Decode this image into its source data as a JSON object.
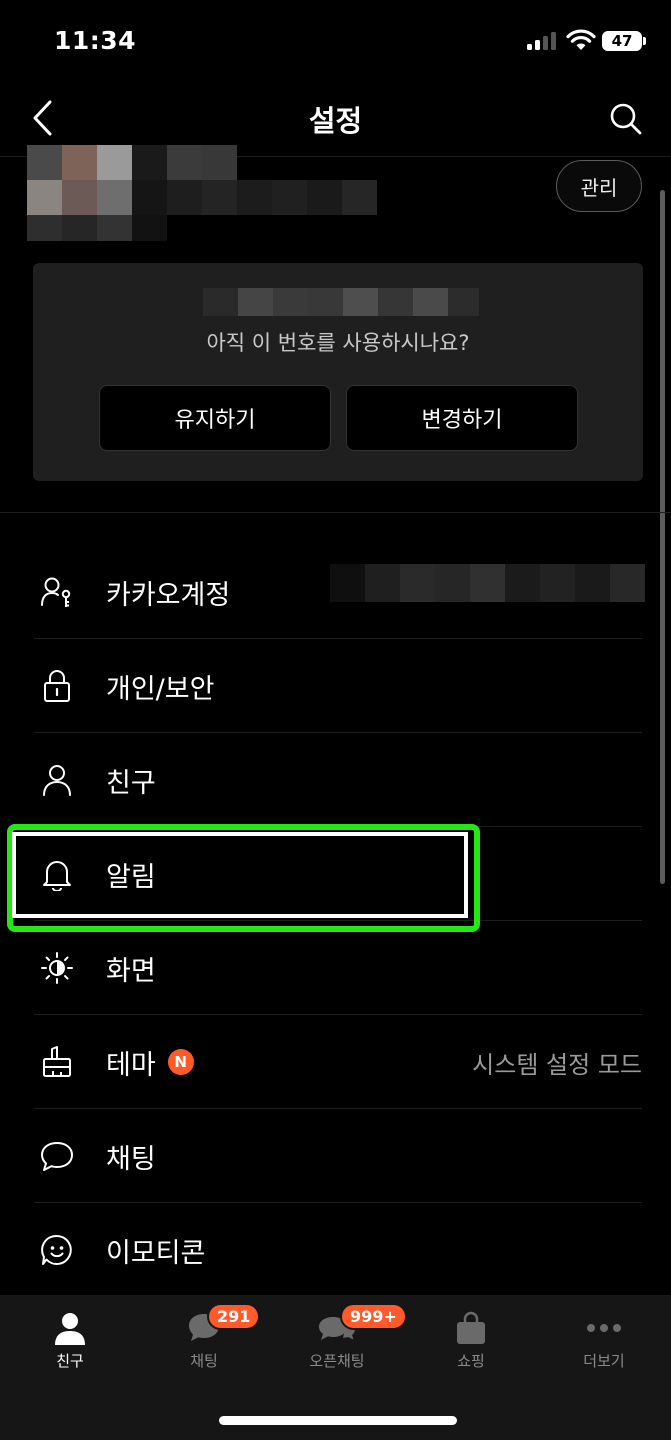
{
  "status": {
    "time": "11:34",
    "battery": "47"
  },
  "header": {
    "title": "설정"
  },
  "profile": {
    "manage_label": "관리"
  },
  "phone_check": {
    "question": "아직 이 번호를 사용하시나요?",
    "keep_label": "유지하기",
    "change_label": "변경하기"
  },
  "menu": [
    {
      "label": "카카오계정",
      "icon": "account-key-icon"
    },
    {
      "label": "개인/보안",
      "icon": "lock-icon"
    },
    {
      "label": "친구",
      "icon": "person-icon"
    },
    {
      "label": "알림",
      "icon": "bell-icon"
    },
    {
      "label": "화면",
      "icon": "brightness-icon"
    },
    {
      "label": "테마",
      "icon": "brush-icon",
      "badge": "N",
      "value": "시스템 설정 모드"
    },
    {
      "label": "채팅",
      "icon": "chat-bubble-icon"
    },
    {
      "label": "이모티콘",
      "icon": "emoticon-icon"
    }
  ],
  "tabs": [
    {
      "label": "친구",
      "icon": "person-icon",
      "active": true
    },
    {
      "label": "채팅",
      "icon": "chat-bubble-icon",
      "badge": "291"
    },
    {
      "label": "오픈채팅",
      "icon": "open-chat-icon",
      "badge": "999+"
    },
    {
      "label": "쇼핑",
      "icon": "shopping-bag-icon"
    },
    {
      "label": "더보기",
      "icon": "more-dots-icon"
    }
  ],
  "colors": {
    "highlight": "#27e617",
    "badge": "#ff5a2c",
    "card_bg": "#1f1f1f",
    "tabbar_bg": "#161616"
  }
}
